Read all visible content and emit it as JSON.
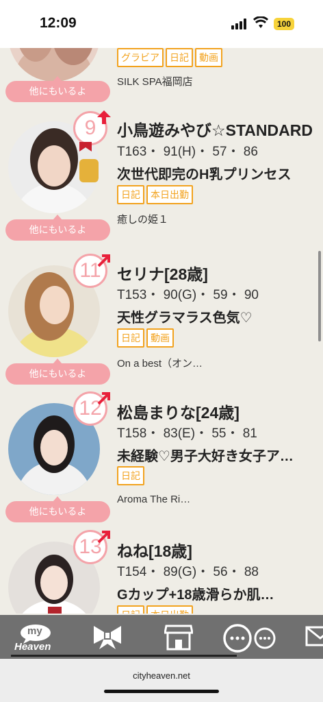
{
  "status": {
    "time": "12:09",
    "battery": "100"
  },
  "entries": [
    {
      "name": "",
      "specs": "",
      "catch": "",
      "tags": [
        "グラビア",
        "日記",
        "動画"
      ],
      "shop": "SILK SPA福岡店",
      "other_label": "他にもいるよ"
    },
    {
      "rank": "9",
      "name": "小鳥遊みやび☆STANDARD",
      "specs": "T163・ 91(H)・ 57・ 86",
      "catch": "次世代即完のH乳プリンセス",
      "tags": [
        "日記",
        "本日出勤"
      ],
      "shop": "癒しの姫１",
      "other_label": "他にもいるよ"
    },
    {
      "rank": "11",
      "name": "セリナ[28歳]",
      "specs": "T153・ 90(G)・ 59・ 90",
      "catch": "天性グラマラス色気♡",
      "tags": [
        "日記",
        "動画"
      ],
      "shop": "On a best（オン…",
      "other_label": "他にもいるよ"
    },
    {
      "rank": "12",
      "name": "松島まりな[24歳]",
      "specs": "T158・ 83(E)・ 55・ 81",
      "catch": "未経験♡男子大好き女子ア…",
      "tags": [
        "日記"
      ],
      "shop": "Aroma The Ri…",
      "other_label": "他にもいるよ"
    },
    {
      "rank": "13",
      "name": "ねね[18歳]",
      "specs": "T154・ 89(G)・ 56・ 88",
      "catch": "Gカップ+18歳滑らか肌…",
      "tags": [
        "日記",
        "本日出勤"
      ],
      "shop": "",
      "other_label": ""
    }
  ],
  "nav": {
    "mypage_top": "my",
    "mypage_bottom": "Heaven",
    "items": [
      "mypage-icon",
      "ribbon-icon",
      "shop-icon",
      "chat-icon",
      "mail-icon"
    ]
  },
  "browser": {
    "url": "cityheaven.net"
  },
  "colors": {
    "accent": "#f4a3a9",
    "tag": "#f2a21d",
    "background": "#efede6",
    "nav": "#707070",
    "rank_up": "#e8203a"
  }
}
